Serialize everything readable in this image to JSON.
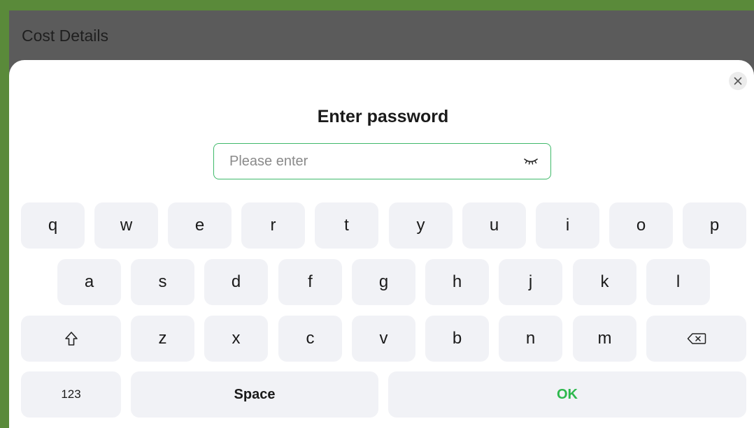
{
  "header": {
    "title": "Cost Details"
  },
  "dialog": {
    "title": "Enter password",
    "close_icon": "close-icon",
    "password": {
      "value": "",
      "placeholder": "Please enter",
      "toggle_icon": "eye-closed-icon"
    }
  },
  "keyboard": {
    "row1": [
      "q",
      "w",
      "e",
      "r",
      "t",
      "y",
      "u",
      "i",
      "o",
      "p"
    ],
    "row2": [
      "a",
      "s",
      "d",
      "f",
      "g",
      "h",
      "j",
      "k",
      "l"
    ],
    "row3": [
      "z",
      "x",
      "c",
      "v",
      "b",
      "n",
      "m"
    ],
    "shift_icon": "shift-icon",
    "backspace_icon": "backspace-icon",
    "numbers_label": "123",
    "space_label": "Space",
    "ok_label": "OK"
  },
  "colors": {
    "frame": "#5a8a3a",
    "header_bg": "#5b5b5b",
    "accent": "#2db84d",
    "key_bg": "#f1f2f6",
    "input_border": "#3fb96a"
  }
}
